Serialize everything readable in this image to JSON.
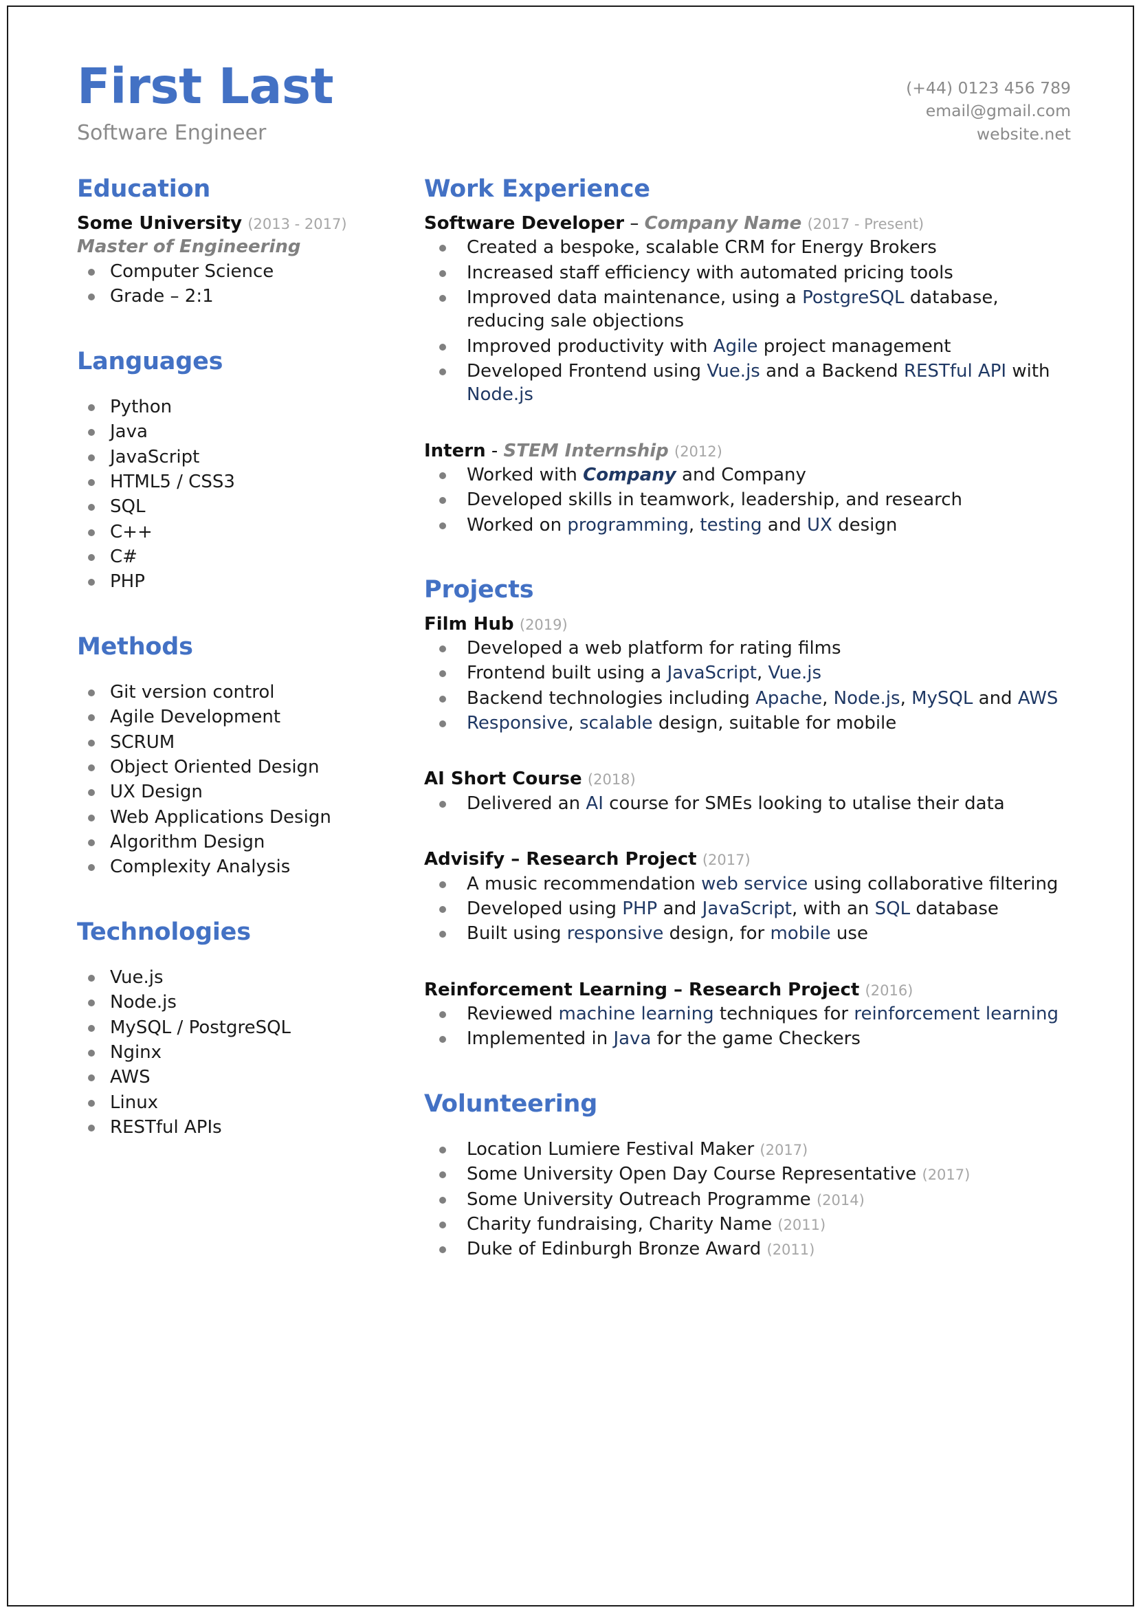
{
  "theme": {
    "heading_blue": "#4371C4",
    "accent_navy": "#1F3864",
    "muted_gray": "#808080",
    "year_gray": "#A6A6A6",
    "body_black": "#1A1A1A"
  },
  "header": {
    "name": "First Last",
    "job_title": "Software Engineer",
    "phone": "(+44) 0123 456 789",
    "email": "email@gmail.com",
    "website": "website.net"
  },
  "left": {
    "education": {
      "title": "Education",
      "school": "Some University",
      "school_years": "(2013 - 2017)",
      "degree": "Master of Engineering",
      "bullets": [
        "Computer Science",
        "Grade – 2:1"
      ]
    },
    "languages": {
      "title": "Languages",
      "items": [
        "Python",
        "Java",
        "JavaScript",
        "HTML5 / CSS3",
        "SQL",
        "C++",
        "C#",
        "PHP"
      ]
    },
    "methods": {
      "title": "Methods",
      "items": [
        "Git version control",
        "Agile Development",
        "SCRUM",
        "Object Oriented Design",
        "UX Design",
        "Web Applications Design",
        "Algorithm Design",
        "Complexity Analysis"
      ]
    },
    "technologies": {
      "title": "Technologies",
      "items": [
        "Vue.js",
        "Node.js",
        "MySQL / PostgreSQL",
        "Nginx",
        "AWS",
        "Linux",
        "RESTful APIs"
      ]
    }
  },
  "right": {
    "work": {
      "title": "Work Experience",
      "jobs": [
        {
          "role": "Software Developer",
          "separator": "–",
          "org": "Company Name",
          "years": "(2017 - Present)"
        },
        {
          "role": "Intern",
          "separator": "-",
          "org": "STEM Internship",
          "years": "(2012)"
        }
      ],
      "job1_bullets": [
        "Created a bespoke, scalable CRM for Energy Brokers",
        "Increased staff efficiency with automated pricing tools",
        "Improved data maintenance, using a PostgreSQL database, reducing sale objections",
        "Improved productivity with Agile project management",
        "Developed Frontend using Vue.js and a Backend RESTful API with Node.js"
      ],
      "job2_bullets": [
        "Worked with Company and Company",
        "Developed skills in teamwork, leadership, and research",
        "Worked on programming, testing and UX design"
      ]
    },
    "projects": {
      "title": "Projects",
      "items": [
        {
          "name": "Film Hub",
          "years": "(2019)",
          "bullets": [
            "Developed a web platform for rating films",
            "Frontend built using a JavaScript, Vue.js",
            "Backend technologies including Apache, Node.js, MySQL and AWS",
            "Responsive, scalable design, suitable for mobile"
          ]
        },
        {
          "name": "AI Short Course",
          "years": "(2018)",
          "bullets": [
            "Delivered an AI course for SMEs looking to utalise their data"
          ]
        },
        {
          "name": "Advisify – Research Project",
          "years": "(2017)",
          "bullets": [
            "A music recommendation web service using collaborative filtering",
            "Developed using PHP and JavaScript, with an SQL database",
            "Built using responsive design, for mobile use"
          ]
        },
        {
          "name": "Reinforcement Learning – Research Project",
          "years": "(2016)",
          "bullets": [
            "Reviewed machine learning techniques for reinforcement learning",
            "Implemented in Java for the game Checkers"
          ]
        }
      ]
    },
    "volunteering": {
      "title": "Volunteering",
      "items": [
        {
          "text": "Location Lumiere Festival Maker",
          "year": "(2017)"
        },
        {
          "text": "Some University Open Day Course Representative",
          "year": "(2017)"
        },
        {
          "text": "Some University Outreach Programme",
          "year": "(2014)"
        },
        {
          "text": "Charity fundraising, Charity Name",
          "year": "(2011)"
        },
        {
          "text": "Duke of Edinburgh Bronze Award",
          "year": "(2011)"
        }
      ]
    }
  }
}
